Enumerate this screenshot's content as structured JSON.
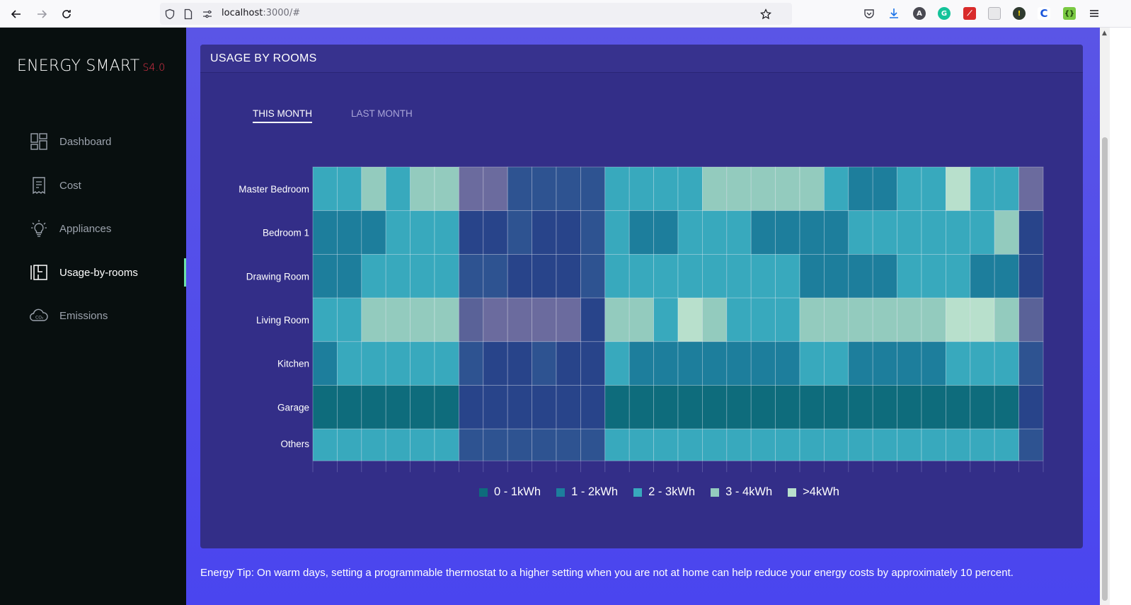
{
  "browser": {
    "url_host": "localhost",
    "url_rest": ":3000/#"
  },
  "app": {
    "brand": "ENERGY SMART",
    "version": "S4.0"
  },
  "sidebar": {
    "items": [
      {
        "label": "Dashboard",
        "icon": "dashboard-icon"
      },
      {
        "label": "Cost",
        "icon": "cost-icon"
      },
      {
        "label": "Appliances",
        "icon": "bulb-icon"
      },
      {
        "label": "Usage-by-rooms",
        "icon": "rooms-icon",
        "active": true
      },
      {
        "label": "Emissions",
        "icon": "cloud-co2-icon"
      }
    ]
  },
  "card": {
    "title": "USAGE BY ROOMS",
    "tabs": [
      {
        "label": "THIS MONTH",
        "active": true
      },
      {
        "label": "LAST MONTH",
        "active": false
      }
    ]
  },
  "chart_data": {
    "type": "heatmap",
    "rows": [
      "Master Bedroom",
      "Bedroom 1",
      "Drawing Room",
      "Living Room",
      "Kitchen",
      "Garage",
      "Others"
    ],
    "columns": 30,
    "level_colors": [
      "#0e6c7c",
      "#1d7e9c",
      "#38a9bd",
      "#93cbbe",
      "#b8e0cc"
    ],
    "weekend_colors": [
      "#24417f",
      "#28448a",
      "#2e5391",
      "#5a6298",
      "#6b6b9e"
    ],
    "legend": [
      "0 - 1kWh",
      "1 - 2kWh",
      "2 - 3kWh",
      "3 - 4kWh",
      ">4kWh"
    ],
    "levels": [
      [
        2,
        2,
        3,
        2,
        3,
        3,
        4,
        4,
        2,
        2,
        2,
        2,
        2,
        2,
        2,
        2,
        3,
        3,
        3,
        3,
        3,
        2,
        1,
        1,
        2,
        2,
        4,
        2,
        2,
        4
      ],
      [
        1,
        1,
        1,
        2,
        2,
        2,
        1,
        1,
        2,
        1,
        1,
        2,
        2,
        1,
        1,
        2,
        2,
        2,
        1,
        1,
        1,
        1,
        2,
        2,
        2,
        2,
        2,
        2,
        3,
        1
      ],
      [
        1,
        1,
        2,
        2,
        2,
        2,
        2,
        2,
        1,
        1,
        1,
        2,
        2,
        2,
        2,
        2,
        2,
        2,
        2,
        2,
        1,
        1,
        1,
        1,
        2,
        2,
        2,
        1,
        1,
        1
      ],
      [
        2,
        2,
        3,
        3,
        3,
        3,
        3,
        4,
        4,
        4,
        4,
        1,
        3,
        3,
        2,
        4,
        3,
        2,
        2,
        2,
        3,
        3,
        3,
        3,
        3,
        3,
        4,
        4,
        3,
        3
      ],
      [
        1,
        2,
        2,
        2,
        2,
        2,
        2,
        1,
        1,
        2,
        1,
        1,
        2,
        1,
        1,
        1,
        1,
        1,
        1,
        1,
        2,
        2,
        1,
        1,
        1,
        1,
        2,
        2,
        2,
        2
      ],
      [
        0,
        0,
        0,
        0,
        0,
        0,
        1,
        1,
        1,
        1,
        1,
        1,
        0,
        0,
        0,
        0,
        0,
        0,
        0,
        0,
        0,
        0,
        0,
        0,
        0,
        0,
        0,
        0,
        0,
        1
      ],
      [
        2,
        2,
        2,
        2,
        2,
        2,
        2,
        2,
        2,
        2,
        2,
        2,
        2,
        2,
        2,
        2,
        2,
        2,
        2,
        2,
        2,
        2,
        2,
        2,
        2,
        2,
        2,
        2,
        2,
        2
      ]
    ],
    "muted_columns": [
      6,
      7,
      8,
      9,
      10,
      11,
      29
    ]
  },
  "tip": "Energy Tip: On warm days, setting a programmable thermostat to a higher setting when you are not at home can help reduce your energy costs by approximately 10 percent."
}
